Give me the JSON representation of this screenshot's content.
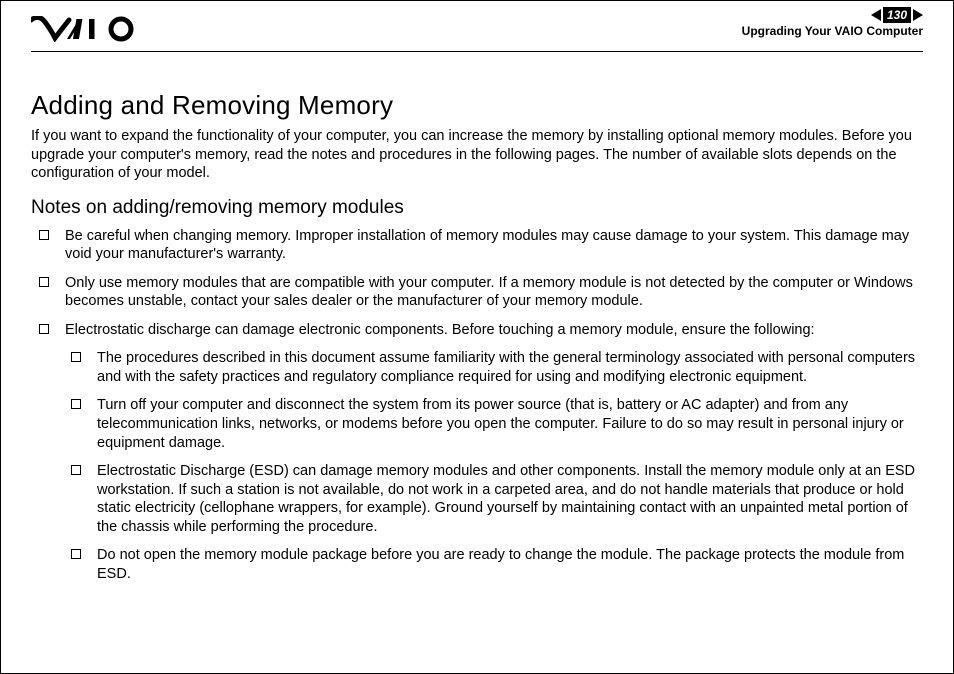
{
  "header": {
    "page_number": "130",
    "section_title": "Upgrading Your VAIO Computer",
    "logo_alt": "VAIO"
  },
  "content": {
    "title": "Adding and Removing Memory",
    "intro": "If you want to expand the functionality of your computer, you can increase the memory by installing optional memory modules. Before you upgrade your computer's memory, read the notes and procedures in the following pages. The number of available slots depends on the configuration of your model.",
    "subheading": "Notes on adding/removing memory modules",
    "bullets": [
      "Be careful when changing memory. Improper installation of memory modules may cause damage to your system. This damage may void your manufacturer's warranty.",
      "Only use memory modules that are compatible with your computer. If a memory module is not detected by the computer or Windows becomes unstable, contact your sales dealer or the manufacturer of your memory module.",
      "Electrostatic discharge can damage electronic components. Before touching a memory module, ensure the following:"
    ],
    "nested": [
      "The procedures described in this document assume familiarity with the general terminology associated with personal computers and with the safety practices and regulatory compliance required for using and modifying electronic equipment.",
      "Turn off your computer and disconnect the system from its power source (that is, battery or AC adapter) and from any telecommunication links, networks, or modems before you open the computer. Failure to do so may result in personal injury or equipment damage.",
      "Electrostatic Discharge (ESD) can damage memory modules and other components. Install the memory module only at an ESD workstation. If such a station is not available, do not work in a carpeted area, and do not handle materials that produce or hold static electricity (cellophane wrappers, for example). Ground yourself by maintaining contact with an unpainted metal portion of the chassis while performing the procedure.",
      "Do not open the memory module package before you are ready to change the module. The package protects the module from ESD."
    ]
  }
}
